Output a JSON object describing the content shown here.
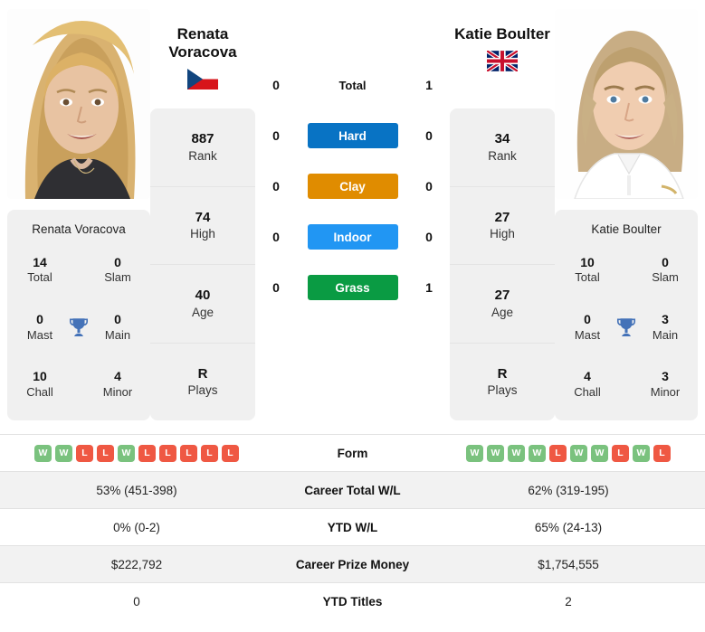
{
  "players": {
    "left": {
      "name_line1": "Renata",
      "name_line2": "Voracova",
      "full_name": "Renata Voracova",
      "flag": "czech-republic-flag",
      "rank": "887",
      "rank_label": "Rank",
      "high": "74",
      "high_label": "High",
      "age": "40",
      "age_label": "Age",
      "plays": "R",
      "plays_label": "Plays",
      "titles": {
        "total": "14",
        "total_label": "Total",
        "slam": "0",
        "slam_label": "Slam",
        "mast": "0",
        "mast_label": "Mast",
        "main": "0",
        "main_label": "Main",
        "chall": "10",
        "chall_label": "Chall",
        "minor": "4",
        "minor_label": "Minor"
      },
      "form": [
        "W",
        "W",
        "L",
        "L",
        "W",
        "L",
        "L",
        "L",
        "L",
        "L"
      ],
      "career_total_wl": "53% (451-398)",
      "ytd_wl": "0% (0-2)",
      "career_prize_money": "$222,792",
      "ytd_titles": "0"
    },
    "right": {
      "name_line1": "Katie Boulter",
      "name_line2": "",
      "full_name": "Katie Boulter",
      "flag": "united-kingdom-flag",
      "rank": "34",
      "rank_label": "Rank",
      "high": "27",
      "high_label": "High",
      "age": "27",
      "age_label": "Age",
      "plays": "R",
      "plays_label": "Plays",
      "titles": {
        "total": "10",
        "total_label": "Total",
        "slam": "0",
        "slam_label": "Slam",
        "mast": "0",
        "mast_label": "Mast",
        "main": "3",
        "main_label": "Main",
        "chall": "4",
        "chall_label": "Chall",
        "minor": "3",
        "minor_label": "Minor"
      },
      "form": [
        "W",
        "W",
        "W",
        "W",
        "L",
        "W",
        "W",
        "L",
        "W",
        "L"
      ],
      "career_total_wl": "62% (319-195)",
      "ytd_wl": "65% (24-13)",
      "career_prize_money": "$1,754,555",
      "ytd_titles": "2"
    }
  },
  "head_to_head": {
    "total": {
      "label": "Total",
      "left": "0",
      "right": "1"
    },
    "surfaces": [
      {
        "label": "Hard",
        "left": "0",
        "right": "0",
        "color": "#0873c4"
      },
      {
        "label": "Clay",
        "left": "0",
        "right": "0",
        "color": "#e08c00"
      },
      {
        "label": "Indoor",
        "left": "0",
        "right": "0",
        "color": "#2196f3"
      },
      {
        "label": "Grass",
        "left": "0",
        "right": "1",
        "color": "#0a9b43"
      }
    ]
  },
  "table": {
    "rows": [
      {
        "label": "Form"
      },
      {
        "label": "Career Total W/L"
      },
      {
        "label": "YTD W/L"
      },
      {
        "label": "Career Prize Money"
      },
      {
        "label": "YTD Titles"
      }
    ]
  },
  "colors": {
    "win_badge": "#7ac27e",
    "loss_badge": "#ef5843",
    "trophy": "#4472b8",
    "panel": "#f0f0f0"
  }
}
